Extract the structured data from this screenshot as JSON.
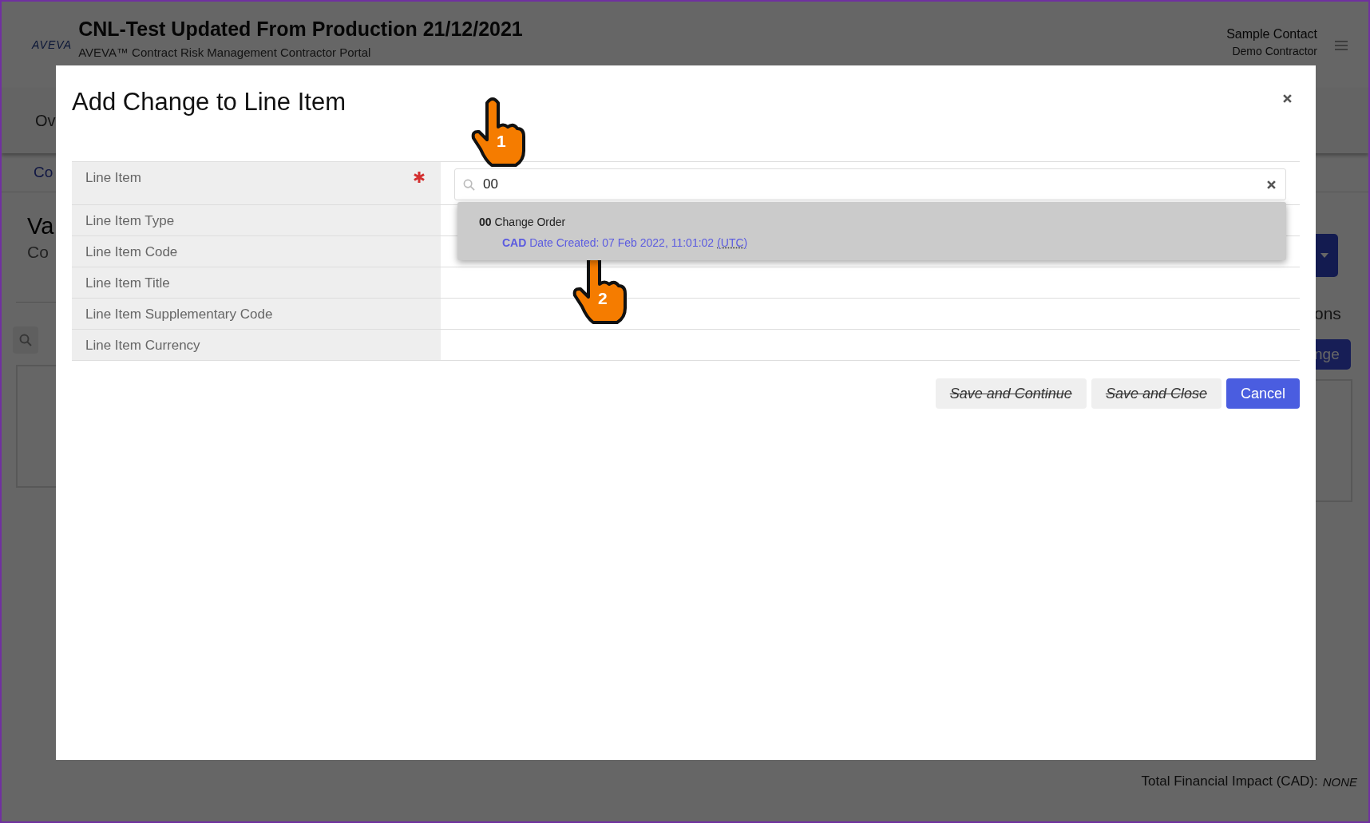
{
  "header": {
    "logo": "AVEVA",
    "title": "CNL-Test Updated From Production 21/12/2021",
    "subtitle": "AVEVA™ Contract Risk Management Contractor Portal",
    "user_name": "Sample Contact",
    "user_role": "Demo Contractor"
  },
  "background": {
    "nav_tab": "Ov",
    "breadcrumb": "Co",
    "heading": "Va",
    "subheading": "Co",
    "section_label": "ons",
    "action_button": "nge",
    "total_label": "Total Financial Impact (CAD):",
    "total_value": "NONE"
  },
  "modal": {
    "title": "Add Change to Line Item",
    "fields": [
      {
        "label": "Line Item",
        "required": true
      },
      {
        "label": "Line Item Type",
        "required": false
      },
      {
        "label": "Line Item Code",
        "required": false
      },
      {
        "label": "Line Item Title",
        "required": false
      },
      {
        "label": "Line Item Supplementary Code",
        "required": false
      },
      {
        "label": "Line Item Currency",
        "required": false
      }
    ],
    "search": {
      "value": "00"
    },
    "suggestions": [
      {
        "line1": "**00** Change Order",
        "line2": "**CAD** Date Created: 07 Feb 2022, 11:01:02",
        "abbr": "(UTC)"
      }
    ],
    "buttons": [
      {
        "label": "Save and Continue",
        "kind": "secondary",
        "disabled": true
      },
      {
        "label": "Save and Close",
        "kind": "secondary",
        "disabled": true
      },
      {
        "label": "Cancel",
        "kind": "primary",
        "disabled": false
      }
    ]
  },
  "callouts": [
    {
      "number": "1"
    },
    {
      "number": "2"
    }
  ]
}
